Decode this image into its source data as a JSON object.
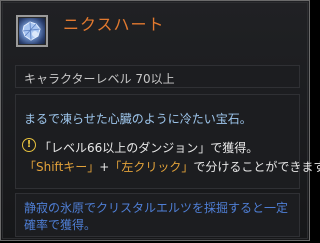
{
  "item": {
    "icon": "frozen-heart-gem-icon",
    "name": "ニクスハート"
  },
  "requirement": "キャラクターレベル 70以上",
  "description": "まるで凍らせた心臓のように冷たい宝石。",
  "hint": {
    "icon": "warning-icon",
    "line1": "「レベル66以上のダンジョン」で獲得。",
    "line2_key1": "「Shiftキー」",
    "line2_plus": "+",
    "line2_key2": "「左クリック」",
    "line2_rest": "で分けることができます。"
  },
  "obtain_info": "静寂の氷原でクリスタルエルツを採掘すると一定確率で獲得。",
  "colors": {
    "name": "#e2792f",
    "description": "#9ec6ec",
    "key": "#e2a23a",
    "obtain": "#4f7fd6",
    "warning": "#e6c13e"
  }
}
